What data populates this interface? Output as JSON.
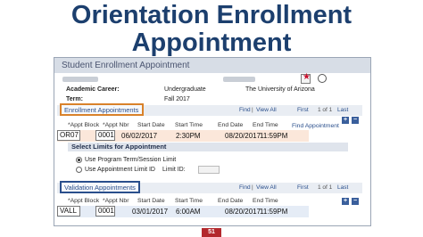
{
  "slide": {
    "title_line1": "Orientation Enrollment",
    "title_line2": "Appointment",
    "page_number": "51"
  },
  "panel": {
    "title": "Student Enrollment Appointment",
    "academic_career_label": "Academic Career:",
    "academic_career_value": "Undergraduate",
    "institution_value": "The University of Arizona",
    "term_label": "Term:",
    "term_value": "Fall 2017"
  },
  "enrollment": {
    "section_label": "Enrollment Appointments",
    "find_label": "Find",
    "view_all_label": "View All",
    "first_label": "First",
    "pager_text": "1 of 1",
    "last_label": "Last",
    "columns": [
      "*Appt Block",
      "*Appt Nbr",
      "Start Date",
      "Start Time",
      "End Date",
      "End Time"
    ],
    "find_appointment_label": "Find Appointment",
    "row": {
      "block": "OR07",
      "nbr": "0001",
      "start_date": "06/02/2017",
      "start_time": "2:30PM",
      "end_date": "08/20/2017",
      "end_time": "11:59PM"
    }
  },
  "select_limits": {
    "title": "Select Limits for Appointment",
    "option_program": "Use Program Term/Session Limit",
    "option_appt": "Use Appointment Limit ID",
    "limit_id_label": "Limit ID:"
  },
  "validation": {
    "section_label": "Validation Appointments",
    "find_label": "Find",
    "view_all_label": "View All",
    "first_label": "First",
    "pager_text": "1 of 1",
    "last_label": "Last",
    "columns": [
      "*Appt Block",
      "*Appt Nbr",
      "Start Date",
      "Start Time",
      "End Date",
      "End Time"
    ],
    "row": {
      "block": "VALL",
      "nbr": "0001",
      "start_date": "03/01/2017",
      "start_time": "6:00AM",
      "end_date": "08/20/2017",
      "end_time": "11:59PM"
    }
  },
  "colors": {
    "title": "#1c3f6e",
    "enrollment_outline": "#d9822b",
    "validation_outline": "#2a4f8c",
    "badge": "#b3282d"
  },
  "icons": [
    "print-icon",
    "search-icon",
    "add-row-icon",
    "delete-row-icon",
    "radio-icon"
  ]
}
